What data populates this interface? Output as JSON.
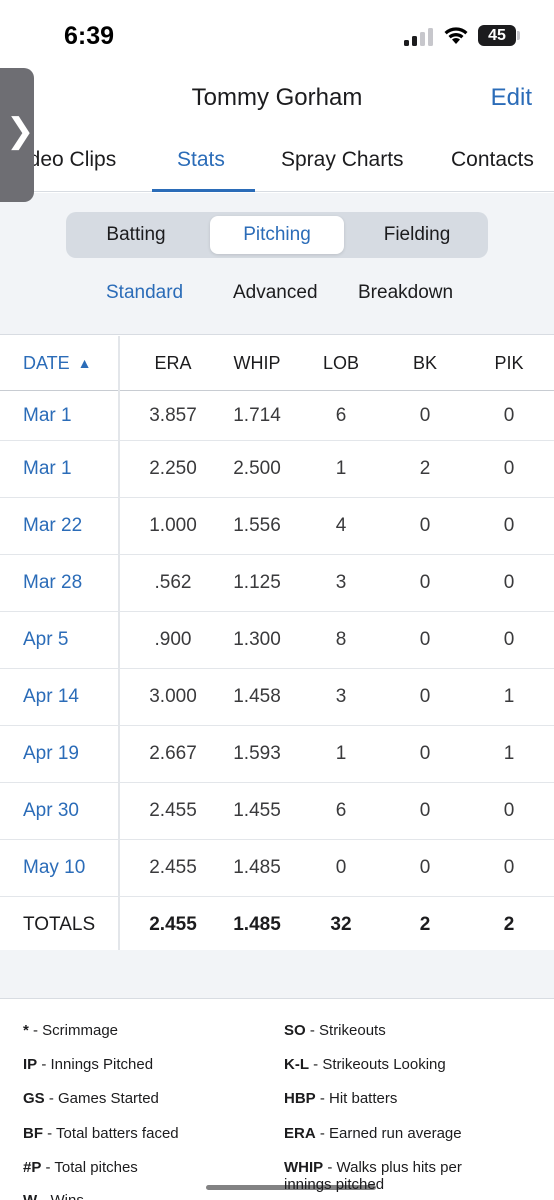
{
  "status_bar": {
    "time": "6:39",
    "battery": "45"
  },
  "header": {
    "title": "Tommy Gorham",
    "edit_label": "Edit",
    "side_handle_icon": "chevron-right-icon"
  },
  "top_tabs": [
    {
      "label": "ideo Clips"
    },
    {
      "label": "Stats"
    },
    {
      "label": "Spray Charts"
    },
    {
      "label": "Contacts"
    }
  ],
  "segments": [
    {
      "label": "Batting"
    },
    {
      "label": "Pitching"
    },
    {
      "label": "Fielding"
    }
  ],
  "sub_tabs": [
    {
      "label": "Standard"
    },
    {
      "label": "Advanced"
    },
    {
      "label": "Breakdown"
    }
  ],
  "table": {
    "headers": [
      "DATE",
      "ERA",
      "WHIP",
      "LOB",
      "BK",
      "PIK"
    ],
    "rows": [
      [
        "Mar 1",
        "3.857",
        "1.714",
        "6",
        "0",
        "0"
      ],
      [
        "Mar 1",
        "2.250",
        "2.500",
        "1",
        "2",
        "0"
      ],
      [
        "Mar 22",
        "1.000",
        "1.556",
        "4",
        "0",
        "0"
      ],
      [
        "Mar 28",
        ".562",
        "1.125",
        "3",
        "0",
        "0"
      ],
      [
        "Apr 5",
        ".900",
        "1.300",
        "8",
        "0",
        "0"
      ],
      [
        "Apr 14",
        "3.000",
        "1.458",
        "3",
        "0",
        "1"
      ],
      [
        "Apr 19",
        "2.667",
        "1.593",
        "1",
        "0",
        "1"
      ],
      [
        "Apr 30",
        "2.455",
        "1.455",
        "6",
        "0",
        "0"
      ],
      [
        "May 10",
        "2.455",
        "1.485",
        "0",
        "0",
        "0"
      ]
    ],
    "totals": [
      "TOTALS",
      "2.455",
      "1.485",
      "32",
      "2",
      "2"
    ]
  },
  "legend": {
    "left": [
      {
        "abbr": "*",
        "desc": " - Scrimmage"
      },
      {
        "abbr": "IP",
        "desc": " - Innings Pitched"
      },
      {
        "abbr": "GS",
        "desc": " - Games Started"
      },
      {
        "abbr": "BF",
        "desc": " - Total batters faced"
      },
      {
        "abbr": "#P",
        "desc": " - Total pitches"
      },
      {
        "abbr": "W",
        "desc": " - Wins"
      }
    ],
    "right": [
      {
        "abbr": "SO",
        "desc": " - Strikeouts"
      },
      {
        "abbr": "K-L",
        "desc": " - Strikeouts Looking"
      },
      {
        "abbr": "HBP",
        "desc": " - Hit batters"
      },
      {
        "abbr": "ERA",
        "desc": " - Earned run average"
      },
      {
        "abbr": "WHIP",
        "desc": " - Walks plus hits per"
      },
      {
        "abbr": "",
        "desc": "innings pitched"
      }
    ]
  },
  "colors": {
    "accent": "#2b6cb8",
    "panel": "#f2f4f7"
  }
}
